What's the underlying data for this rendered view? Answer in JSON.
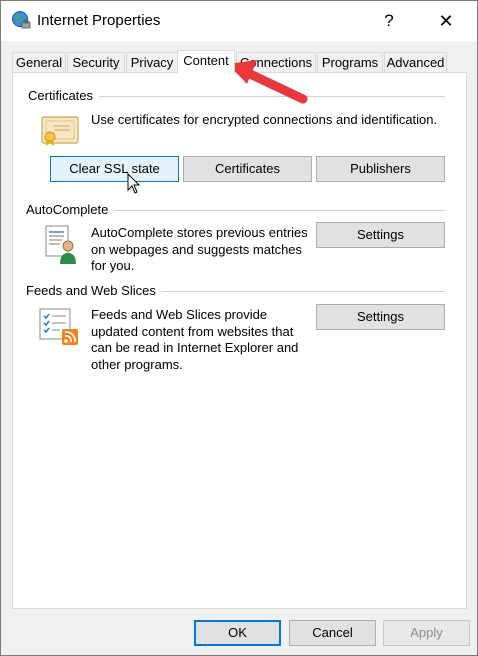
{
  "window": {
    "title": "Internet Properties",
    "help_glyph": "?",
    "close_glyph": "✕"
  },
  "tabs": [
    {
      "label": "General"
    },
    {
      "label": "Security"
    },
    {
      "label": "Privacy"
    },
    {
      "label": "Content",
      "active": true
    },
    {
      "label": "Connections"
    },
    {
      "label": "Programs"
    },
    {
      "label": "Advanced"
    }
  ],
  "certificates": {
    "heading": "Certificates",
    "description": "Use certificates for encrypted connections and identification.",
    "buttons": {
      "clear_ssl": "Clear SSL state",
      "certificates": "Certificates",
      "publishers": "Publishers"
    }
  },
  "autocomplete": {
    "heading": "AutoComplete",
    "description_lines": [
      "AutoComplete stores previous entries",
      "on webpages and suggests matches",
      "for you."
    ],
    "settings": "Settings"
  },
  "feeds": {
    "heading": "Feeds and Web Slices",
    "description_lines": [
      "Feeds and Web Slices provide",
      "updated content from websites that",
      "can be read in Internet Explorer and",
      "other programs."
    ],
    "settings": "Settings"
  },
  "footer": {
    "ok": "OK",
    "cancel": "Cancel",
    "apply": "Apply"
  },
  "colors": {
    "accent": "#0078d7",
    "arrow": "#e8383d",
    "rss": "#f58220"
  }
}
